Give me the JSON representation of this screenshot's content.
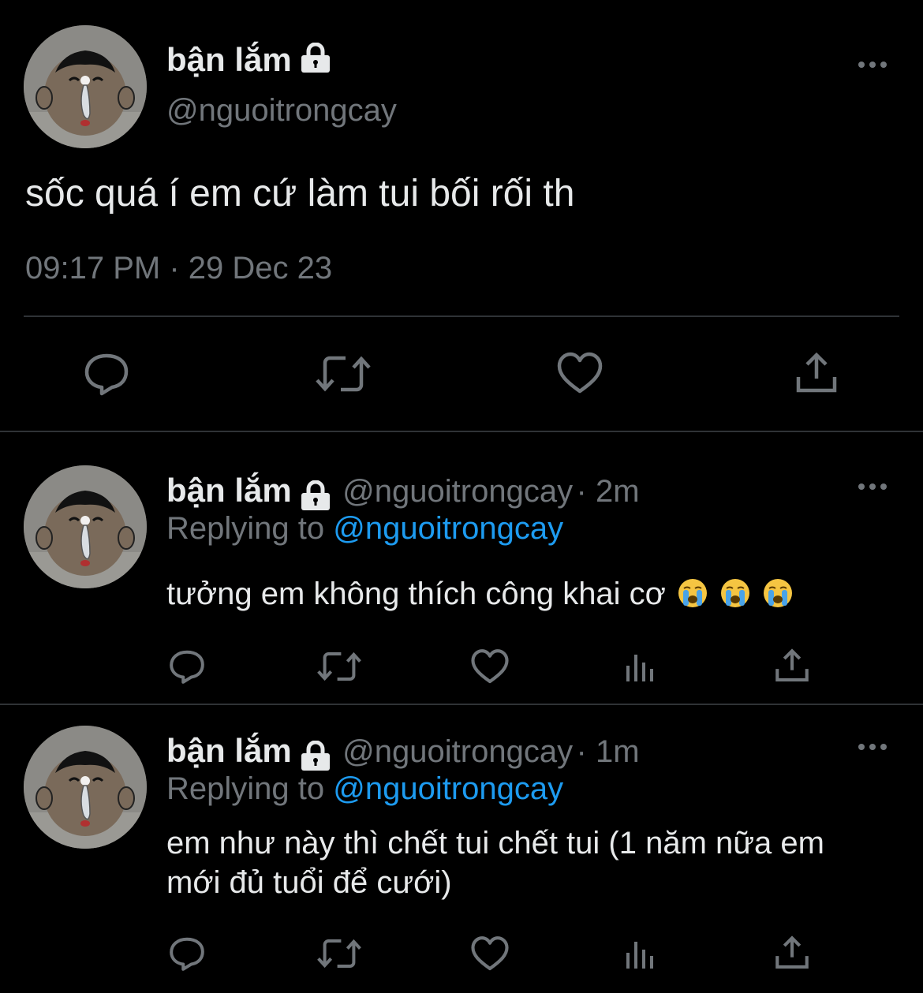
{
  "main_tweet": {
    "display_name": "bận lắm",
    "handle": "@nguoitrongcay",
    "text": "sốc quá í em cứ làm tui bối rối th",
    "timestamp": "09:17 PM · 29 Dec 23",
    "actions": [
      "reply-icon",
      "retweet-icon",
      "like-icon",
      "share-icon"
    ]
  },
  "replies": [
    {
      "display_name": "bận lắm",
      "handle": "@nguoitrongcay",
      "time": "· 2m",
      "replying_prefix": "Replying to",
      "replying_to": "@nguoitrongcay",
      "text": "tưởng em không thích công khai cơ",
      "emojis": [
        "loudly-crying-face",
        "loudly-crying-face",
        "loudly-crying-face"
      ]
    },
    {
      "display_name": "bận lắm",
      "handle": "@nguoitrongcay",
      "time": "· 1m",
      "replying_prefix": "Replying to",
      "replying_to": "@nguoitrongcay",
      "text_line1": "em như này thì chết tui chết tui (1 năm nữa em",
      "text_line2": "mới đủ tuổi để cưới)"
    }
  ],
  "colors": {
    "background": "#000000",
    "text_primary": "#e7e9ea",
    "text_secondary": "#71767b",
    "accent": "#1d9bf0",
    "divider": "#2f3336"
  }
}
